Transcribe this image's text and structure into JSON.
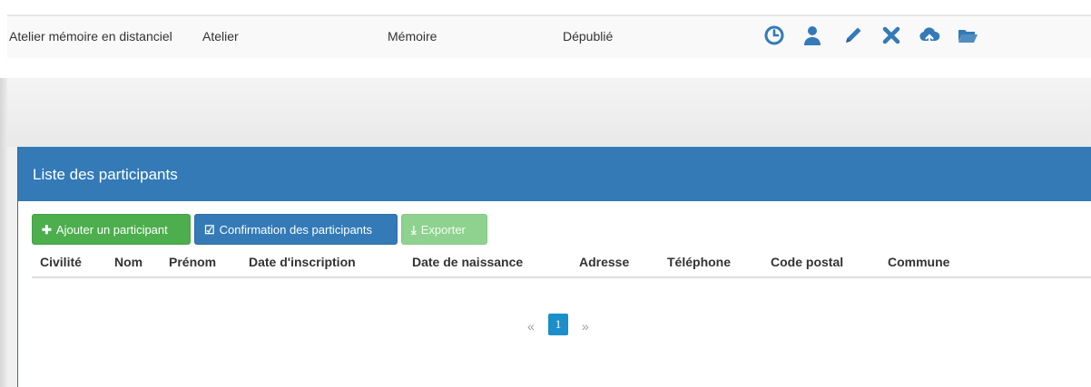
{
  "event_row": {
    "title": "Atelier mémoire en distanciel",
    "type": "Atelier",
    "theme": "Mémoire",
    "status": "Dépublié",
    "action_icons": [
      "clock-icon",
      "user-icon",
      "pencil-icon",
      "close-icon",
      "cloud-upload-icon",
      "folder-open-icon"
    ],
    "icon_color": "#337ab7"
  },
  "panel": {
    "title": "Liste des participants",
    "header_color": "#337ab7"
  },
  "buttons": {
    "add": "Ajouter un participant",
    "confirm": "Confirmation des participants",
    "export": "Exporter"
  },
  "table": {
    "columns": [
      "Civilité",
      "Nom",
      "Prénom",
      "Date d'inscription",
      "Date de naissance",
      "Adresse",
      "Téléphone",
      "Code postal",
      "Commune"
    ]
  },
  "pagination": {
    "prev": "«",
    "current": "1",
    "next": "»"
  }
}
